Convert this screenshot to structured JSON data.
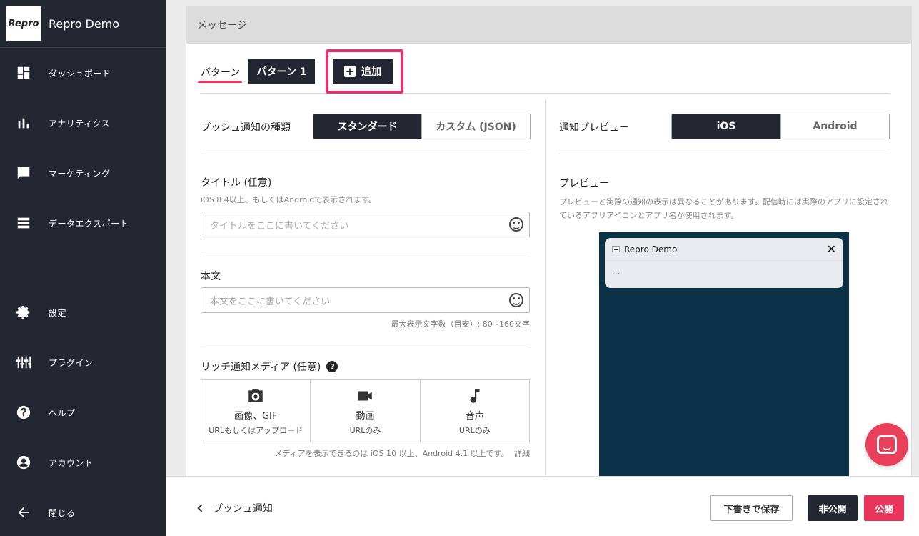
{
  "sidebar": {
    "brand_logo": "Repro",
    "brand_name": "Repro Demo",
    "items": [
      {
        "label": "ダッシュボード",
        "icon": "dashboard-icon"
      },
      {
        "label": "アナリティクス",
        "icon": "bar-chart-icon"
      },
      {
        "label": "マーケティング",
        "icon": "message-icon"
      },
      {
        "label": "データエクスポート",
        "icon": "list-icon"
      },
      {
        "label": "設定",
        "icon": "gear-icon"
      },
      {
        "label": "プラグイン",
        "icon": "plugin-icon"
      },
      {
        "label": "ヘルプ",
        "icon": "help-icon"
      },
      {
        "label": "アカウント",
        "icon": "account-icon"
      },
      {
        "label": "閉じる",
        "icon": "arrow-left-icon"
      }
    ]
  },
  "card": {
    "header": "メッセージ",
    "pattern_label": "パターン",
    "pattern1": "パターン 1",
    "add_label": "追加"
  },
  "left": {
    "push_type_label": "プッシュ通知の種類",
    "push_type_options": [
      "スタンダード",
      "カスタム (JSON)"
    ],
    "title_label": "タイトル (任意)",
    "title_note": "iOS 8.4以上、もしくはAndroidで表示されます。",
    "title_placeholder": "タイトルをここに書いてください",
    "body_label": "本文",
    "body_placeholder": "本文をここに書いてください",
    "body_note": "最大表示文字数（目安）: 80~160文字",
    "media_label": "リッチ通知メディア (任意)",
    "media": [
      {
        "name": "画像、GIF",
        "sub": "URLもしくはアップロード",
        "icon": "camera-icon"
      },
      {
        "name": "動画",
        "sub": "URLのみ",
        "icon": "video-icon"
      },
      {
        "name": "音声",
        "sub": "URLのみ",
        "icon": "music-icon"
      }
    ],
    "media_note": "メディアを表示できるのは iOS 10 以上、Android 4.1 以上です。",
    "media_note_link": "詳細"
  },
  "right": {
    "preview_os_label": "通知プレビュー",
    "os_options": [
      "iOS",
      "Android"
    ],
    "preview_label": "プレビュー",
    "preview_note": "プレビューと実際の通知の表示は異なることがあります。配信時には実際のアプリに設定されているアプリアイコンとアプリ名が使用されます。",
    "notif_app": "Repro Demo",
    "notif_body": "..."
  },
  "footer": {
    "back_label": "プッシュ通知",
    "draft_label": "下書きで保存",
    "private_label": "非公開",
    "publish_label": "公開"
  },
  "colors": {
    "accent": "#e8345a",
    "dark": "#232731",
    "preview_bg": "#0b3146"
  }
}
